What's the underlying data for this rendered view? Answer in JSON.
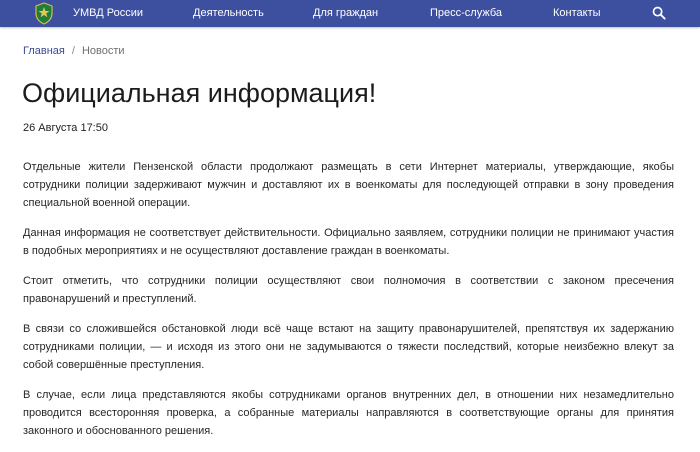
{
  "nav": {
    "brand": "УМВД России",
    "items": [
      "Деятельность",
      "Для граждан",
      "Пресс-служба",
      "Контакты"
    ],
    "search_icon": "search-icon",
    "background": "#3d4f9f"
  },
  "breadcrumb": {
    "home": "Главная",
    "separator": "/",
    "current": "Новости"
  },
  "article": {
    "title": "Официальная информация!",
    "date": "26 Августа 17:50",
    "paragraphs": [
      "Отдельные жители Пензенской области продолжают размещать в сети Интернет материалы, утверждающие, якобы сотрудники полиции задерживают мужчин и доставляют их в военкоматы для последующей отправки в зону проведения специальной военной операции.",
      "Данная информация не соответствует действительности. Официально заявляем, сотрудники полиции не принимают участия в подобных мероприятиях и не осуществляют доставление граждан в военкоматы.",
      "Стоит отметить, что сотрудники полиции осуществляют свои полномочия в соответствии с законом пресечения правонарушений и преступлений.",
      "В связи со сложившейся обстановкой люди всё чаще встают на защиту правонарушителей, препятствуя их задержанию сотрудниками полиции, — и исходя из этого они не задумываются о тяжести последствий, которые неизбежно влекут за собой совершённые преступления.",
      "В случае, если лица представляются якобы сотрудниками органов внутренних дел, в отношении них незамедлительно проводится всесторонняя проверка, а собранные материалы направляются в соответствующие органы для принятия законного и обоснованного решения."
    ]
  }
}
